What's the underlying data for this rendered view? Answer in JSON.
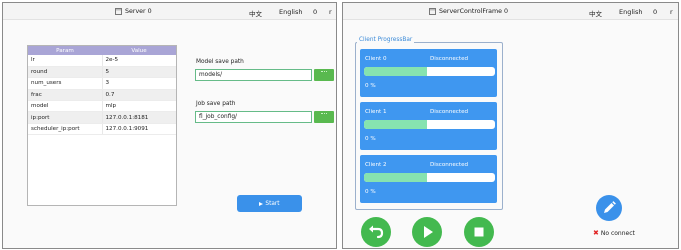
{
  "left_window": {
    "title": "Server 0",
    "lang_zh": "中文",
    "lang_en": "English",
    "counter": "0",
    "extra": "r",
    "table": {
      "headers": [
        "Param",
        "Value"
      ],
      "rows": [
        {
          "param": "lr",
          "value": "2e-5"
        },
        {
          "param": "round",
          "value": "5"
        },
        {
          "param": "num_users",
          "value": "3"
        },
        {
          "param": "frac",
          "value": "0.7"
        },
        {
          "param": "model",
          "value": "mlp"
        },
        {
          "param": "ip:port",
          "value": "127.0.0.1:8181"
        },
        {
          "param": "scheduler_ip:port",
          "value": "127.0.0.1:9091"
        }
      ]
    },
    "model_save": {
      "label": "Model save path",
      "value": "models/"
    },
    "job_save": {
      "label": "Job save path",
      "value": "fl_job_config/"
    },
    "start_label": "Start",
    "colors": {
      "table_header": "#a9a5d6",
      "browse": "#59b94f",
      "start": "#3a91ea"
    }
  },
  "right_window": {
    "title": "ServerControlFrame 0",
    "lang_zh": "中文",
    "lang_en": "English",
    "counter": "0",
    "extra": "r",
    "group_title": "Client ProgressBar",
    "clients": [
      {
        "name": "Client 0",
        "status": "Disconnected",
        "progress": 0.48,
        "progress_text": "0 %"
      },
      {
        "name": "Client 1",
        "status": "Disconnected",
        "progress": 0.48,
        "progress_text": "0 %"
      },
      {
        "name": "Client 2",
        "status": "Disconnected",
        "progress": 0.48,
        "progress_text": "0 %"
      }
    ],
    "controls": [
      {
        "name": "back-button",
        "icon": "back-arrow-icon"
      },
      {
        "name": "play-button",
        "icon": "play-icon"
      },
      {
        "name": "stop-button",
        "icon": "stop-icon"
      }
    ],
    "edit_icon": "pencil-icon",
    "status_text": "No connect",
    "colors": {
      "card": "#3f97f0",
      "progress_fill": "#86e3b0",
      "control": "#43b94f",
      "fab": "#3a91ea",
      "error": "#e02222"
    }
  }
}
